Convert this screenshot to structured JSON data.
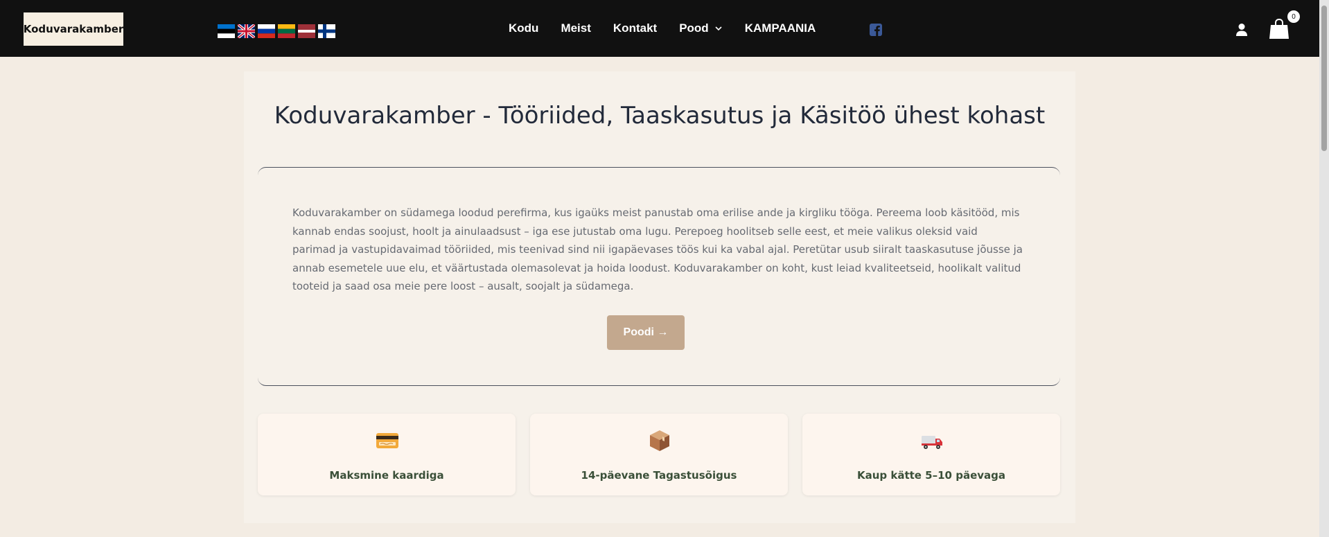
{
  "header": {
    "logo_text": "Koduvarakamber",
    "languages": [
      "et",
      "en",
      "ru",
      "lt",
      "lv",
      "fi"
    ],
    "nav": [
      {
        "label": "Kodu"
      },
      {
        "label": "Meist"
      },
      {
        "label": "Kontakt"
      },
      {
        "label": "Pood",
        "has_dropdown": true
      },
      {
        "label": "KAMPAANIA"
      }
    ],
    "social_icon": "facebook-icon",
    "cart_count": "0",
    "colors": {
      "bar": "#111111",
      "facebook": "#3b5998"
    }
  },
  "main": {
    "title": "Koduvarakamber - Tööriided, Taaskasutus ja Käsitöö ühest kohast",
    "about": "Koduvarakamber on südamega loodud perefirma, kus igaüks meist panustab oma erilise ande ja kirgliku tööga. Pereema loob käsitööd, mis kannab endas soojust, hoolt ja ainulaadsust – iga ese jutustab oma lugu. Perepoeg hoolitseb selle eest, et meie valikus oleksid vaid parimad ja vastupidavaimad tööriided, mis teenivad sind nii igapäevases töös kui ka vabal ajal. Peretütar usub siiralt taaskasutuse jõusse ja annab esemetele uue elu, et väärtustada olemasolevat ja hoida loodust. Koduvarakamber on koht, kust leiad kvaliteetseid, hoolikalt valitud tooteid ja saad osa meie pere loost – ausalt, soojalt ja südamega.",
    "cta_label": "Poodi →",
    "features": [
      {
        "icon": "credit-card-icon",
        "label": "Maksmine kaardiga"
      },
      {
        "icon": "package-icon",
        "label": "14-päevane Tagastusõigus"
      },
      {
        "icon": "delivery-truck-icon",
        "label": "Kaup kätte 5–10 päevaga"
      }
    ],
    "colors": {
      "background": "#f3ece3",
      "button": "#c3a88e",
      "feature_text": "#3a4f38",
      "title": "#222a3a"
    }
  }
}
